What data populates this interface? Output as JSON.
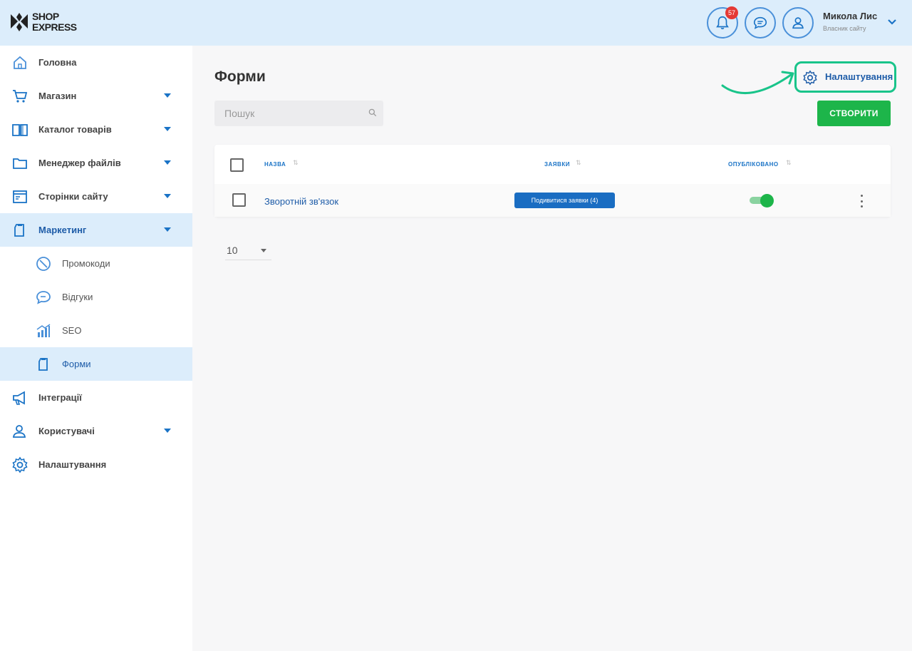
{
  "header": {
    "logo": {
      "line1": "SHOP",
      "line2": "EXPRESS"
    },
    "notifications_count": "57",
    "user": {
      "name": "Микола Лис",
      "role": "Власник сайту"
    }
  },
  "sidebar": {
    "items": [
      {
        "label": "Головна",
        "icon": "home-icon"
      },
      {
        "label": "Магазин",
        "icon": "cart-icon",
        "expandable": true
      },
      {
        "label": "Каталог товарів",
        "icon": "book-icon",
        "expandable": true
      },
      {
        "label": "Менеджер файлів",
        "icon": "folder-icon",
        "expandable": true
      },
      {
        "label": "Сторінки сайту",
        "icon": "browser-icon",
        "expandable": true
      },
      {
        "label": "Маркетинг",
        "icon": "clipboard-icon",
        "expandable": true,
        "active": true
      },
      {
        "label": "Інтеграції",
        "icon": "megaphone-icon"
      },
      {
        "label": "Користувачі",
        "icon": "user-icon",
        "expandable": true
      },
      {
        "label": "Налаштування",
        "icon": "gear-icon"
      }
    ],
    "submenu": [
      {
        "label": "Промокоди",
        "icon": "percent-icon"
      },
      {
        "label": "Відгуки",
        "icon": "chat-icon"
      },
      {
        "label": "SEO",
        "icon": "chart-icon"
      },
      {
        "label": "Форми",
        "icon": "clipboard-icon",
        "active": true
      }
    ]
  },
  "main": {
    "title": "Форми",
    "settings_label": "Налаштування",
    "search_placeholder": "Пошук",
    "create_label": "СТВОРИТИ",
    "table": {
      "columns": [
        "Назва",
        "Заявки",
        "Опубліковано"
      ],
      "rows": [
        {
          "name": "Зворотній зв'язок",
          "requests_label": "Подивитися заявки (4)",
          "published": true
        }
      ]
    },
    "per_page": "10"
  },
  "colors": {
    "header_bg": "#dcedfb",
    "accent": "#1a73c6",
    "create_green": "#1db54a",
    "highlight": "#19c48a"
  }
}
